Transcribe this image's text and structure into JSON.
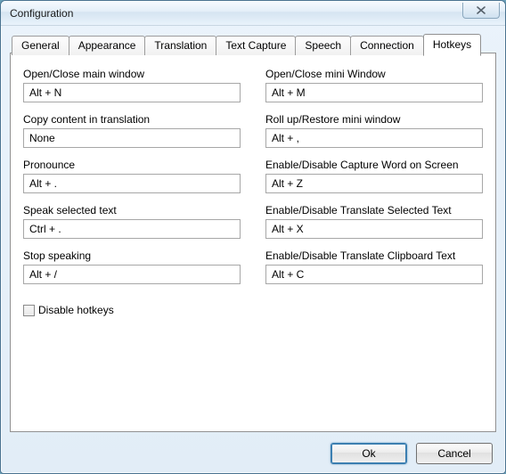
{
  "window": {
    "title": "Configuration"
  },
  "tabs": [
    {
      "label": "General"
    },
    {
      "label": "Appearance"
    },
    {
      "label": "Translation"
    },
    {
      "label": "Text Capture"
    },
    {
      "label": "Speech"
    },
    {
      "label": "Connection"
    },
    {
      "label": "Hotkeys"
    }
  ],
  "activeTab": "Hotkeys",
  "hotkeys": {
    "left": [
      {
        "label": "Open/Close main window",
        "value": "Alt + N"
      },
      {
        "label": "Copy content in translation",
        "value": "None"
      },
      {
        "label": "Pronounce",
        "value": "Alt + ."
      },
      {
        "label": "Speak selected text",
        "value": "Ctrl + ."
      },
      {
        "label": "Stop speaking",
        "value": "Alt + /"
      }
    ],
    "right": [
      {
        "label": "Open/Close mini Window",
        "value": "Alt + M"
      },
      {
        "label": "Roll up/Restore mini window",
        "value": "Alt + ,"
      },
      {
        "label": "Enable/Disable Capture Word on Screen",
        "value": "Alt + Z"
      },
      {
        "label": "Enable/Disable Translate Selected Text",
        "value": "Alt + X"
      },
      {
        "label": "Enable/Disable Translate Clipboard Text",
        "value": "Alt + C"
      }
    ],
    "disable_label": "Disable hotkeys",
    "disable_checked": false
  },
  "buttons": {
    "ok": "Ok",
    "cancel": "Cancel"
  }
}
